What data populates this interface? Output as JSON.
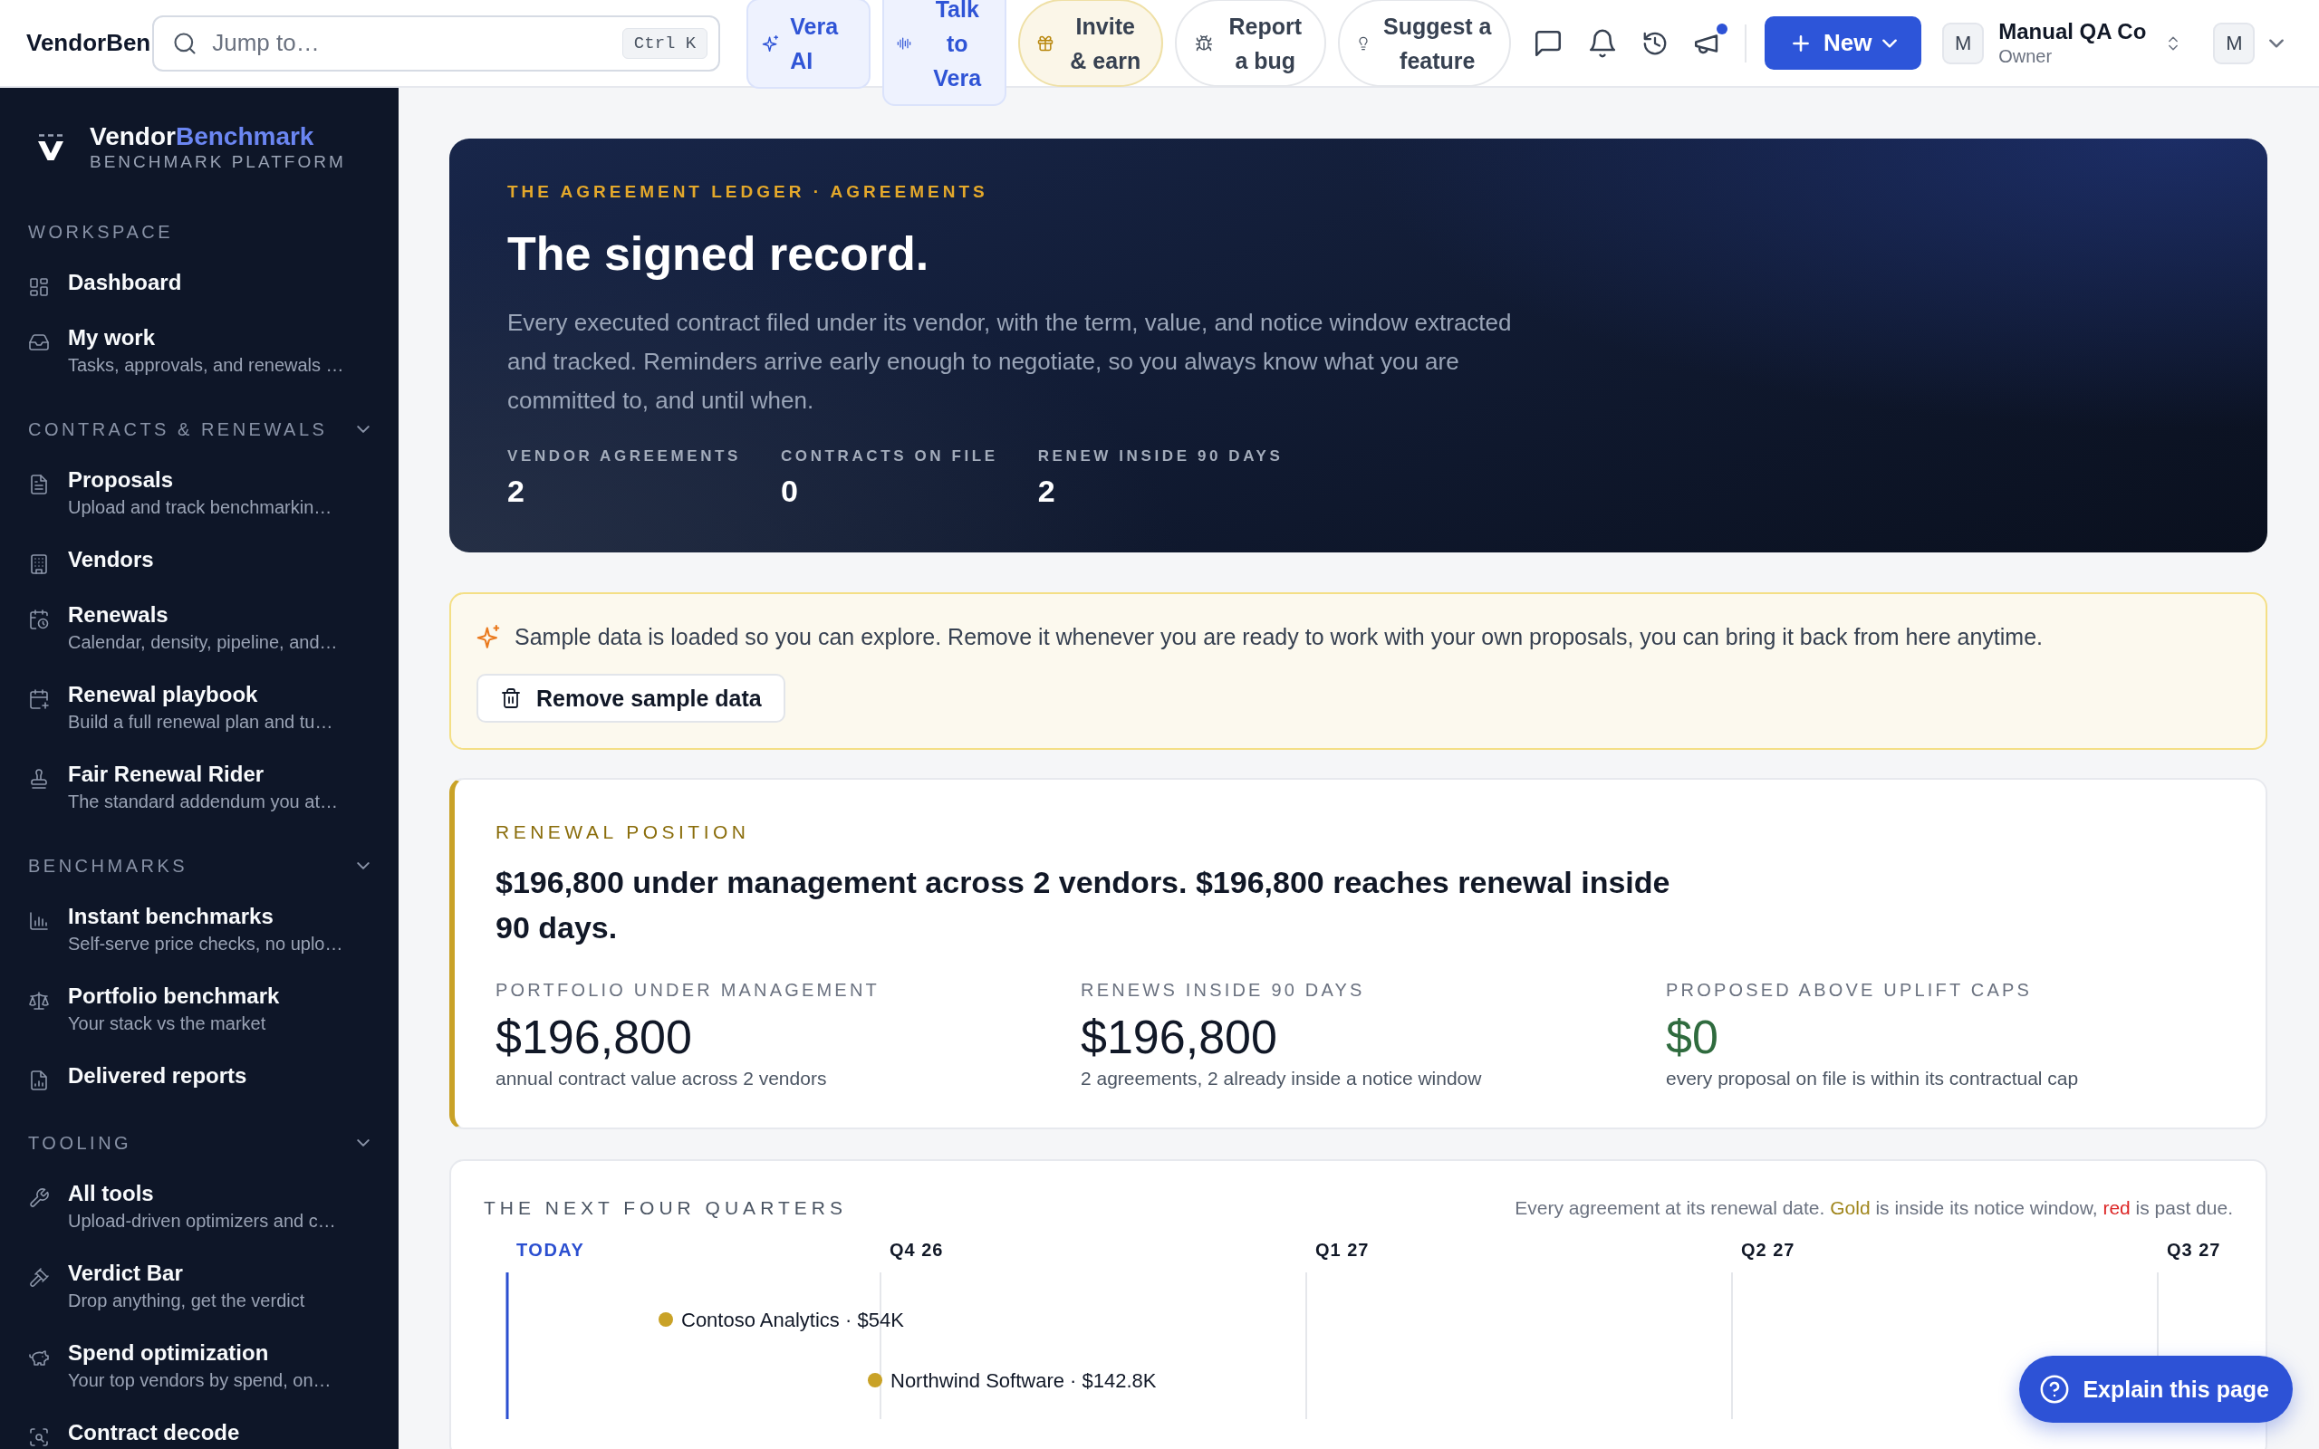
{
  "topbar": {
    "brand_text": "VendorBen",
    "search": {
      "placeholder": "Jump to…",
      "shortcut": "Ctrl K"
    },
    "actions": [
      {
        "kind": "assistant",
        "label": "Vera AI"
      },
      {
        "kind": "assistant",
        "label": "Talk to Vera"
      },
      {
        "kind": "promo",
        "label": "Invite & earn"
      },
      {
        "kind": "feedback",
        "label": "Report a bug"
      },
      {
        "kind": "feedback",
        "label": "Suggest a feature"
      }
    ],
    "icon_buttons": [
      {
        "unread": false
      },
      {
        "unread": false
      },
      {
        "unread": false
      },
      {
        "unread": true
      }
    ],
    "new_button": {
      "label": "New"
    },
    "workspace": {
      "avatar": "M",
      "name": "Manual QA Co",
      "role": "Owner"
    },
    "user": {
      "avatar": "M"
    }
  },
  "sidebar": {
    "brand": {
      "name": "Vendor",
      "name_accent": "Benchmark",
      "tagline": "BENCHMARK PLATFORM"
    },
    "sections": [
      {
        "title": "WORKSPACE",
        "items": [
          {
            "label": "Dashboard",
            "selected": false
          },
          {
            "label": "My work",
            "description": "Tasks, approvals, and renewals …",
            "selected": false
          }
        ]
      },
      {
        "title": "CONTRACTS & RENEWALS",
        "expanded": true,
        "items": [
          {
            "label": "Proposals",
            "description": "Upload and track benchmarkin…",
            "selected": false
          },
          {
            "label": "Vendors",
            "selected": false
          },
          {
            "label": "Renewals",
            "description": "Calendar, density, pipeline, and…",
            "selected": false
          },
          {
            "label": "Renewal playbook",
            "description": "Build a full renewal plan and tu…",
            "selected": false
          },
          {
            "label": "Fair Renewal Rider",
            "description": "The standard addendum you at…",
            "selected": false
          }
        ]
      },
      {
        "title": "BENCHMARKS",
        "expanded": true,
        "items": [
          {
            "label": "Instant benchmarks",
            "description": "Self-serve price checks, no uplo…",
            "selected": false
          },
          {
            "label": "Portfolio benchmark",
            "description": "Your stack vs the market",
            "selected": false
          },
          {
            "label": "Delivered reports",
            "selected": false
          }
        ]
      },
      {
        "title": "TOOLING",
        "expanded": true,
        "items": [
          {
            "label": "All tools",
            "description": "Upload-driven optimizers and c…",
            "selected": false
          },
          {
            "label": "Verdict Bar",
            "description": "Drop anything, get the verdict",
            "selected": false
          },
          {
            "label": "Spend optimization",
            "description": "Your top vendors by spend, on…",
            "selected": false
          },
          {
            "label": "Contract decode",
            "selected": false
          }
        ]
      }
    ]
  },
  "hero": {
    "eyebrow": "THE AGREEMENT LEDGER · AGREEMENTS",
    "title": "The signed record.",
    "description": "Every executed contract filed under its vendor, with the term, value, and notice window extracted and tracked. Reminders arrive early enough to negotiate, so you always know what you are committed to, and until when.",
    "stats": [
      {
        "label": "VENDOR AGREEMENTS",
        "value": "2"
      },
      {
        "label": "CONTRACTS ON FILE",
        "value": "0"
      },
      {
        "label": "RENEW INSIDE 90 DAYS",
        "value": "2"
      }
    ]
  },
  "sample_notice": {
    "text": "Sample data is loaded so you can explore. Remove it whenever you are ready to work with your own proposals, you can bring it back from here anytime.",
    "button": "Remove sample data"
  },
  "renewal_position": {
    "eyebrow": "RENEWAL POSITION",
    "headline": "$196,800 under management across 2 vendors. $196,800 reaches renewal inside 90 days.",
    "stats": [
      {
        "kind": "neutral",
        "label": "PORTFOLIO UNDER MANAGEMENT",
        "value": "$196,800",
        "note": "annual contract value across 2 vendors"
      },
      {
        "kind": "neutral",
        "label": "RENEWS INSIDE 90 DAYS",
        "value": "$196,800",
        "note": "2 agreements, 2 already inside a notice window"
      },
      {
        "kind": "positive",
        "label": "PROPOSED ABOVE UPLIFT CAPS",
        "value": "$0",
        "note": "every proposal on file is within its contractual cap"
      }
    ]
  },
  "timeline": {
    "title": "THE NEXT FOUR QUARTERS",
    "legend": [
      {
        "kind": "plain",
        "text": "Every agreement at its renewal date."
      },
      {
        "kind": "gold",
        "text": "Gold"
      },
      {
        "kind": "plain",
        "text": "is inside its notice window,"
      },
      {
        "kind": "red",
        "text": "red"
      },
      {
        "kind": "plain",
        "text": "is past due."
      }
    ],
    "today_label": "TODAY",
    "quarters": [
      "Q4 26",
      "Q1 27",
      "Q2 27",
      "Q3 27"
    ],
    "agreements": [
      {
        "label": "Contoso Analytics · $54K",
        "color": "#c9a227"
      },
      {
        "label": "Northwind Software · $142.8K",
        "color": "#c9a227"
      }
    ]
  },
  "help_button": {
    "label": "Explain this page"
  }
}
